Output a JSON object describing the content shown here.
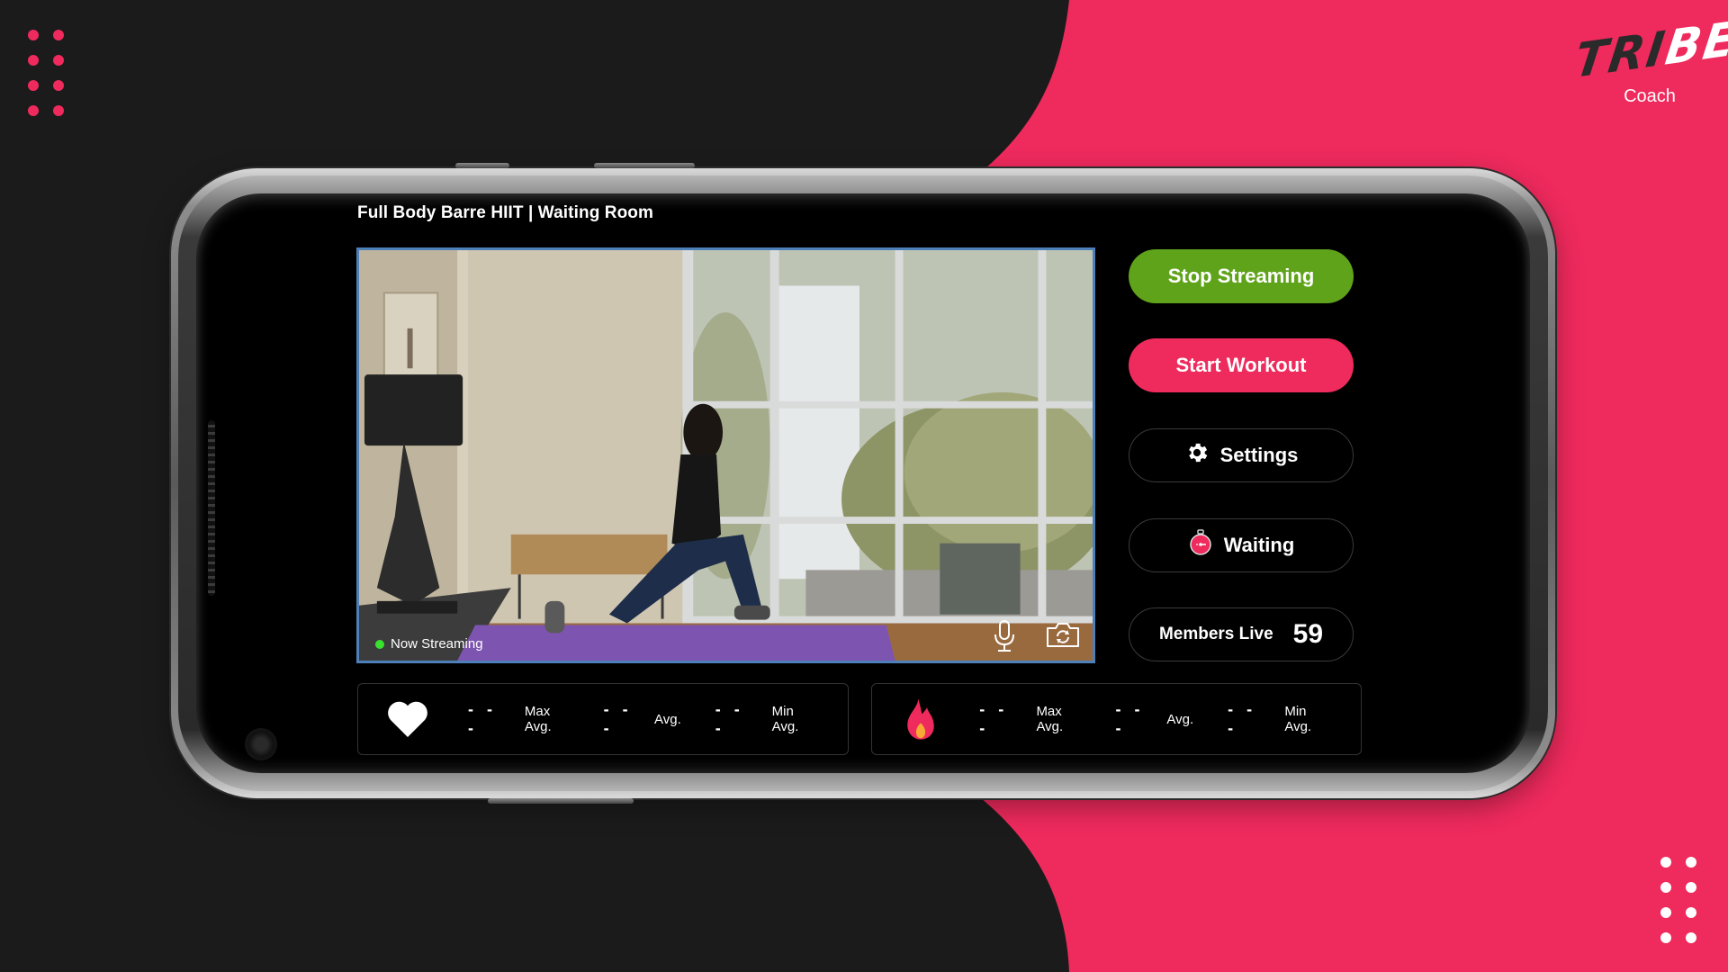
{
  "brand": {
    "logo_part1": "TRI",
    "logo_part2": "BE",
    "subtitle": "Coach",
    "colors": {
      "pink": "#ef2a5d",
      "dark": "#1b1b1b",
      "green": "#5fa31a",
      "live_dot": "#39e22f",
      "video_border": "#4d7fb8"
    }
  },
  "screen": {
    "title": "Full Body Barre HIIT | Waiting Room",
    "video": {
      "status_label": "Now Streaming",
      "controls": [
        {
          "name": "microphone",
          "icon": "mic-icon"
        },
        {
          "name": "switch camera",
          "icon": "camera-flip-icon"
        }
      ]
    },
    "actions": {
      "stop_streaming": "Stop Streaming",
      "start_workout": "Start Workout",
      "settings": "Settings",
      "waiting": "Waiting",
      "members_label": "Members Live",
      "members_count": "59"
    },
    "stats": {
      "heart_rate": {
        "icon": "heart-icon",
        "items": [
          {
            "value": "- - -",
            "label": "Max Avg."
          },
          {
            "value": "- - -",
            "label": "Avg."
          },
          {
            "value": "- - -",
            "label": "Min Avg."
          }
        ]
      },
      "calories": {
        "icon": "flame-icon",
        "items": [
          {
            "value": "- - -",
            "label": "Max Avg."
          },
          {
            "value": "- - -",
            "label": "Avg."
          },
          {
            "value": "- - -",
            "label": "Min Avg."
          }
        ]
      }
    }
  }
}
